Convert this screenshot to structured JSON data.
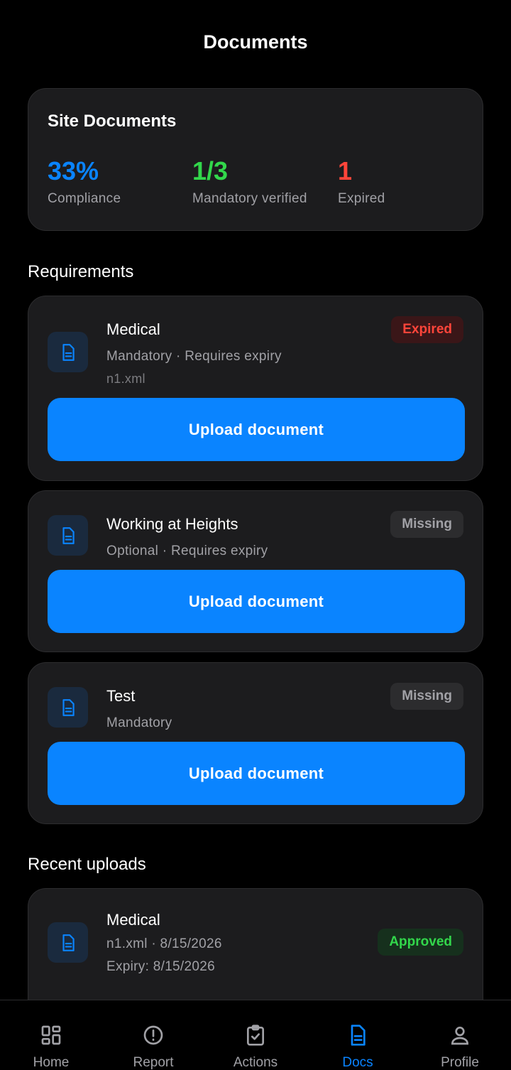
{
  "header": {
    "title": "Documents"
  },
  "summary": {
    "title": "Site Documents",
    "stats": [
      {
        "value": "33%",
        "label": "Compliance",
        "color": "#0a84ff"
      },
      {
        "value": "1/3",
        "label": "Mandatory verified",
        "color": "#32d74b"
      },
      {
        "value": "1",
        "label": "Expired",
        "color": "#ff453a"
      }
    ]
  },
  "requirements": {
    "title": "Requirements",
    "items": [
      {
        "name": "Medical",
        "subtitle": "Mandatory · Requires expiry",
        "file": "n1.xml",
        "status": "Expired",
        "button": "Upload document",
        "icon": "document-icon"
      },
      {
        "name": "Working at Heights",
        "subtitle": "Optional · Requires expiry",
        "status": "Missing",
        "button": "Upload document",
        "icon": "document-icon"
      },
      {
        "name": "Test",
        "subtitle": "Mandatory",
        "status": "Missing",
        "button": "Upload document",
        "icon": "document-icon"
      }
    ]
  },
  "recent": {
    "title": "Recent uploads",
    "items": [
      {
        "name": "Medical",
        "file_line": "n1.xml · 8/15/2026",
        "expiry": "Expiry: 8/15/2026",
        "status": "Approved",
        "icon": "document-icon"
      }
    ]
  },
  "tabbar": {
    "tabs": [
      {
        "label": "Home",
        "icon": "dashboard-icon",
        "active": false
      },
      {
        "label": "Report",
        "icon": "alert-circle-icon",
        "active": false
      },
      {
        "label": "Actions",
        "icon": "clipboard-check-icon",
        "active": false
      },
      {
        "label": "Docs",
        "icon": "document-icon",
        "active": true
      },
      {
        "label": "Profile",
        "icon": "user-icon",
        "active": false
      }
    ]
  },
  "colors": {
    "accent": "#0a84ff",
    "success": "#32d74b",
    "danger": "#ff453a",
    "background": "#000000",
    "card": "#1c1c1e"
  }
}
